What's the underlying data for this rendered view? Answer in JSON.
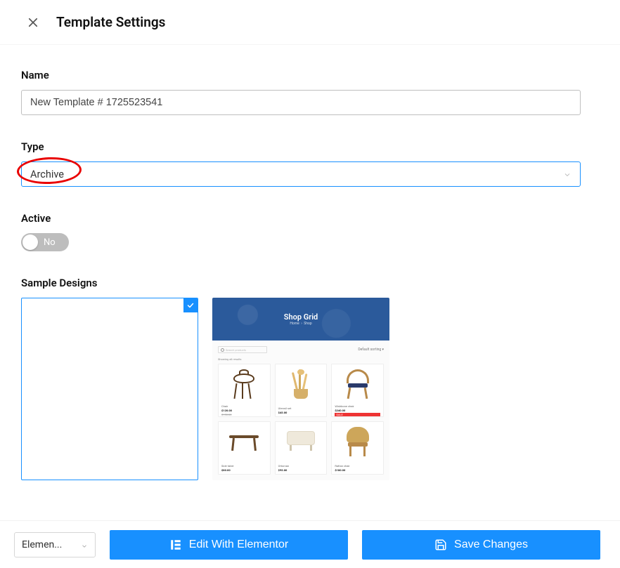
{
  "header": {
    "title": "Template Settings"
  },
  "fields": {
    "name": {
      "label": "Name",
      "value": "New Template # 1725523541"
    },
    "type": {
      "label": "Type",
      "value": "Archive"
    },
    "active": {
      "label": "Active",
      "value": false,
      "off_label": "No"
    },
    "sample_designs": {
      "label": "Sample Designs",
      "selected_index": 0,
      "designs": [
        {
          "name": "blank"
        },
        {
          "name": "shop-grid",
          "banner_title": "Shop Grid"
        }
      ]
    }
  },
  "footer": {
    "editor_select": "Elemen...",
    "edit_button": "Edit With Elementor",
    "save_button": "Save Changes"
  }
}
